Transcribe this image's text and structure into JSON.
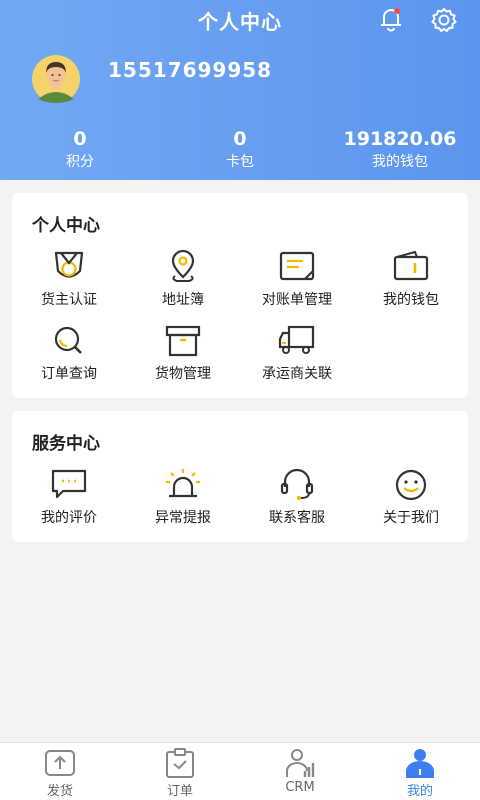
{
  "header": {
    "title": "个人中心",
    "phone": "15517699958",
    "bell_icon": "bell-icon",
    "settings_icon": "gear-icon",
    "has_notification_dot": true
  },
  "stats": [
    {
      "value": "0",
      "label": "积分"
    },
    {
      "value": "0",
      "label": "卡包"
    },
    {
      "value": "191820.06",
      "label": "我的钱包"
    }
  ],
  "personal_center": {
    "title": "个人中心",
    "items": [
      {
        "label": "货主认证",
        "icon": "shipper-certify-icon"
      },
      {
        "label": "地址簿",
        "icon": "location-pin-icon"
      },
      {
        "label": "对账单管理",
        "icon": "statement-icon"
      },
      {
        "label": "我的钱包",
        "icon": "wallet-icon"
      },
      {
        "label": "订单查询",
        "icon": "search-icon"
      },
      {
        "label": "货物管理",
        "icon": "box-icon"
      },
      {
        "label": "承运商关联",
        "icon": "truck-icon"
      }
    ]
  },
  "service_center": {
    "title": "服务中心",
    "items": [
      {
        "label": "我的评价",
        "icon": "chat-icon"
      },
      {
        "label": "异常提报",
        "icon": "alarm-icon"
      },
      {
        "label": "联系客服",
        "icon": "headset-icon"
      },
      {
        "label": "关于我们",
        "icon": "smile-icon"
      }
    ]
  },
  "tabbar": {
    "active_color": "#3d7ef0",
    "tabs": [
      {
        "label": "发货",
        "icon": "upload-icon",
        "active": false
      },
      {
        "label": "订单",
        "icon": "clipboard-icon",
        "active": false
      },
      {
        "label": "CRM",
        "icon": "crm-icon",
        "active": false
      },
      {
        "label": "我的",
        "icon": "person-icon",
        "active": true
      }
    ]
  },
  "colors": {
    "header_start": "#73a8f2",
    "header_end": "#5b95ef",
    "icon_accent": "#f5b800",
    "icon_stroke": "#333333"
  }
}
